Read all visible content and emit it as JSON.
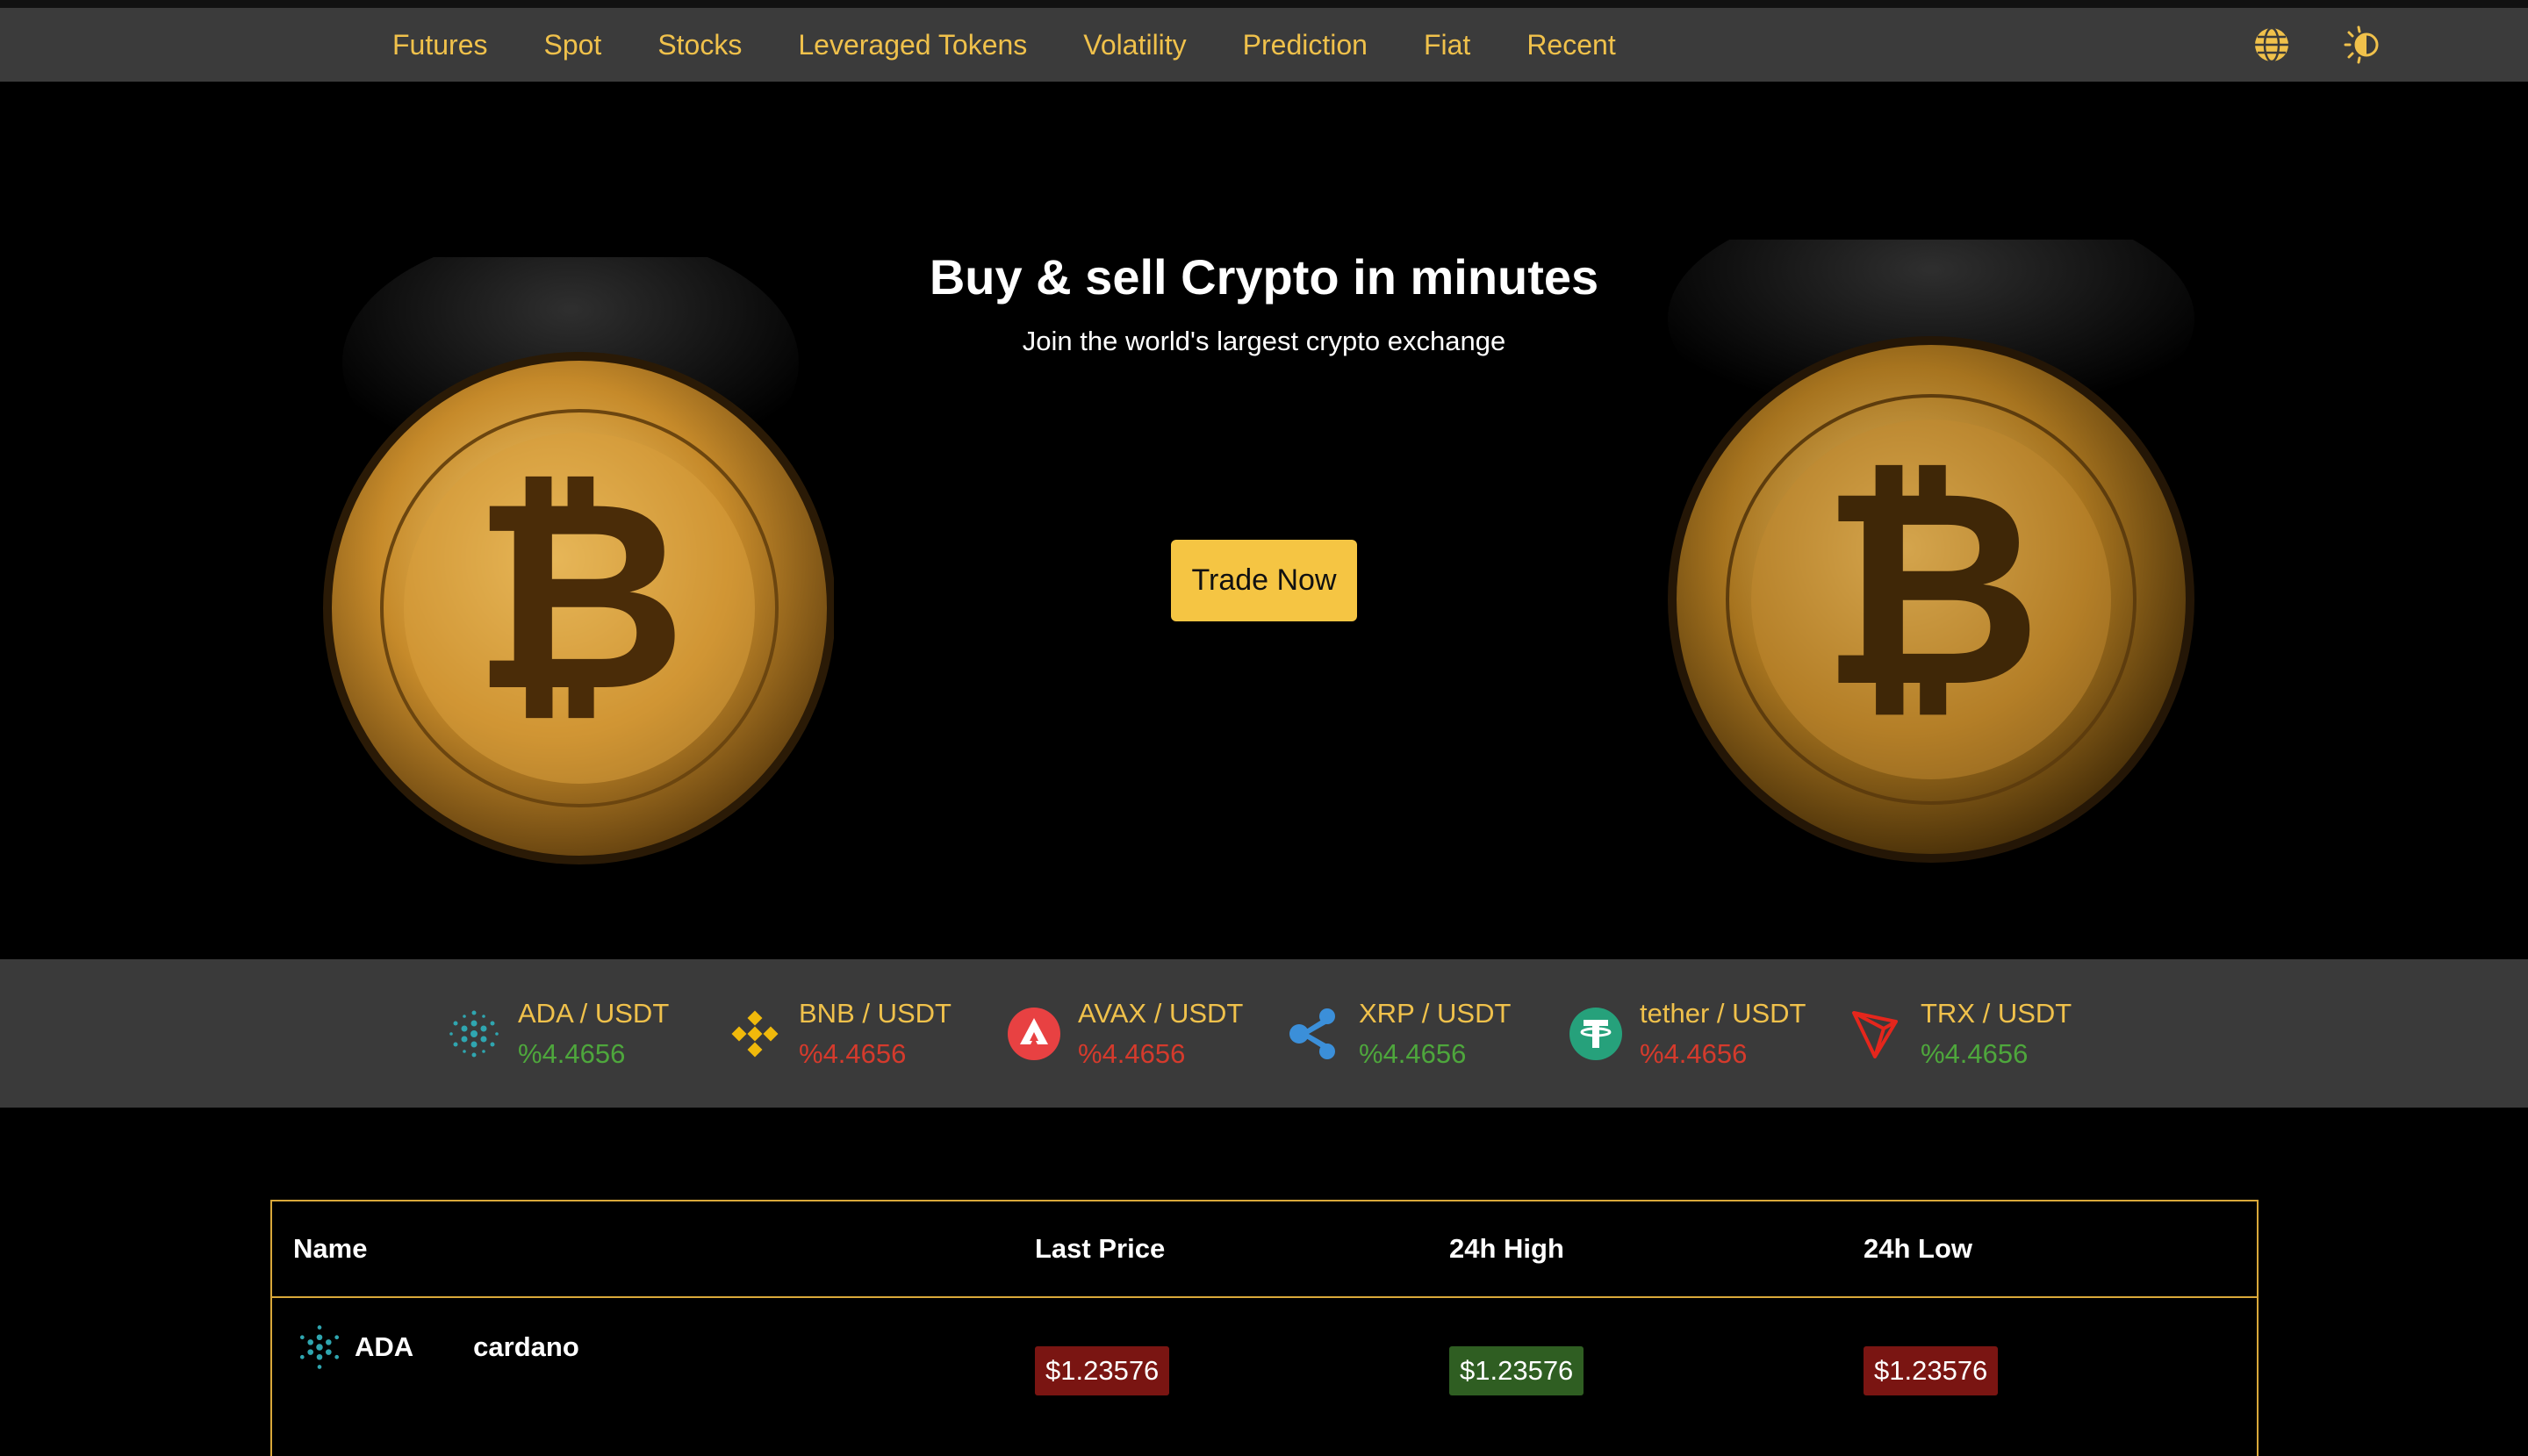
{
  "nav": {
    "items": [
      "Futures",
      "Spot",
      "Stocks",
      "Leveraged Tokens",
      "Volatility",
      "Prediction",
      "Fiat",
      "Recent"
    ],
    "icons": [
      "globe-icon",
      "theme-toggle-icon"
    ],
    "accent": "#f0c14b",
    "background": "#3b3b3b"
  },
  "hero": {
    "title": "Buy & sell Crypto in minutes",
    "subtitle": "Join the world's largest crypto exchange",
    "cta": "Trade Now",
    "cta_color": "#f5c543"
  },
  "ticker": [
    {
      "pair": "ADA / USDT",
      "change": "%4.4656",
      "direction": "up",
      "icon": "cardano-icon"
    },
    {
      "pair": "BNB / USDT",
      "change": "%4.4656",
      "direction": "down",
      "icon": "binance-icon"
    },
    {
      "pair": "AVAX / USDT",
      "change": "%4.4656",
      "direction": "down",
      "icon": "avalanche-icon"
    },
    {
      "pair": "XRP / USDT",
      "change": "%4.4656",
      "direction": "up",
      "icon": "ripple-icon"
    },
    {
      "pair": "tether / USDT",
      "change": "%4.4656",
      "direction": "down",
      "icon": "tether-icon"
    },
    {
      "pair": "TRX / USDT",
      "change": "%4.4656",
      "direction": "up",
      "icon": "tron-icon"
    }
  ],
  "table": {
    "headers": [
      "Name",
      "Last Price",
      "24h High",
      "24h Low"
    ],
    "rows": [
      {
        "symbol": "ADA",
        "name": "cardano",
        "last_price": "$1.23576",
        "high": "$1.23576",
        "low": "$1.23576",
        "icon": "cardano-icon"
      }
    ]
  },
  "colors": {
    "up": "#4ea73c",
    "down": "#d53a2c",
    "border": "#d9a83a"
  }
}
